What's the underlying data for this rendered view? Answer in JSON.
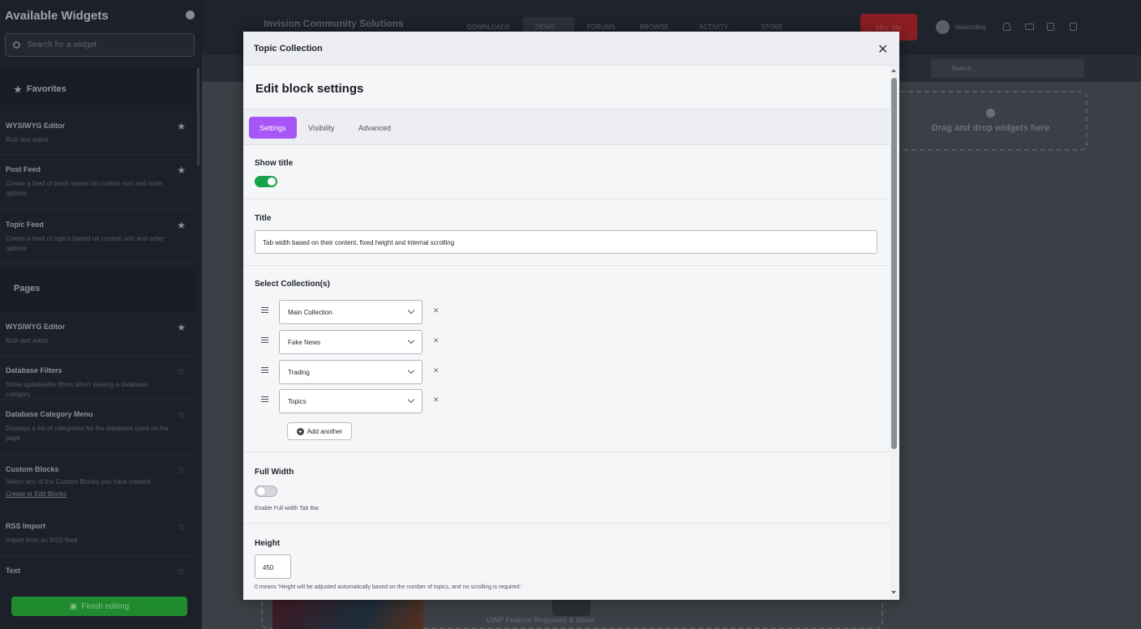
{
  "sidebar": {
    "title": "Available Widgets",
    "search_placeholder": "Search for a widget",
    "sections": {
      "favorites": "Favorites",
      "pages": "Pages"
    },
    "favorites": [
      {
        "title": "WYSIWYG Editor",
        "desc": "Rich text editor",
        "starred": true
      },
      {
        "title": "Post Feed",
        "desc": "Create a feed of posts based on custom sort and order options",
        "starred": true
      },
      {
        "title": "Topic Feed",
        "desc": "Create a feed of topics based on custom sort and order options",
        "starred": true
      }
    ],
    "pages": [
      {
        "title": "WYSIWYG Editor",
        "desc": "Rich text editor",
        "starred": true
      },
      {
        "title": "Database Filters",
        "desc": "Show updateable filters when viewing a database category",
        "starred": false
      },
      {
        "title": "Database Category Menu",
        "desc": "Displays a list of categories for the database used on the page",
        "starred": false
      },
      {
        "title": "Custom Blocks",
        "desc": "Select any of the Custom Blocks you have created",
        "link": "Create or Edit Blocks",
        "starred": false
      },
      {
        "title": "RSS Import",
        "desc": "Import from an RSS feed",
        "starred": false
      },
      {
        "title": "Text",
        "desc": "",
        "starred": false
      }
    ],
    "finish_label": "Finish editing"
  },
  "background": {
    "brand": "Invision Community Solutions",
    "nav": [
      "DOWNLOADS",
      "DEMO",
      "FORUMS",
      "BROWSE",
      "ACTIVITY",
      "STORE"
    ],
    "hire_label": "Hire Me",
    "username": "Valacoding",
    "search_placeholder": "Search...",
    "dropzone_label": "Drag and drop widgets here",
    "bottom_text": "UWP Feature Requests & Ideas"
  },
  "modal": {
    "title": "Topic Collection",
    "heading": "Edit block settings",
    "tabs": [
      "Settings",
      "Visibility",
      "Advanced"
    ],
    "active_tab": "Settings",
    "show_title_label": "Show title",
    "show_title_on": true,
    "title_label": "Title",
    "title_value": "Tab width based on their content, fixed height and internal scrolling",
    "collections_label": "Select Collection(s)",
    "collections": [
      "Main Collection",
      "Fake News",
      "Trading",
      "Topics"
    ],
    "add_another_label": "Add another",
    "full_width_label": "Full Width",
    "full_width_on": false,
    "full_width_hint": "Enable Full width Tab Bar.",
    "height_label": "Height",
    "height_value": "450",
    "height_hint": "0 means 'Height will be adjusted automatically based on the number of topics, and no scrolling is required.'"
  },
  "colors": {
    "accent_tab": "#a855f7",
    "toggle_on": "#16a34a",
    "finish_button": "#1f8a2e",
    "hire_button": "#8b1e24"
  }
}
